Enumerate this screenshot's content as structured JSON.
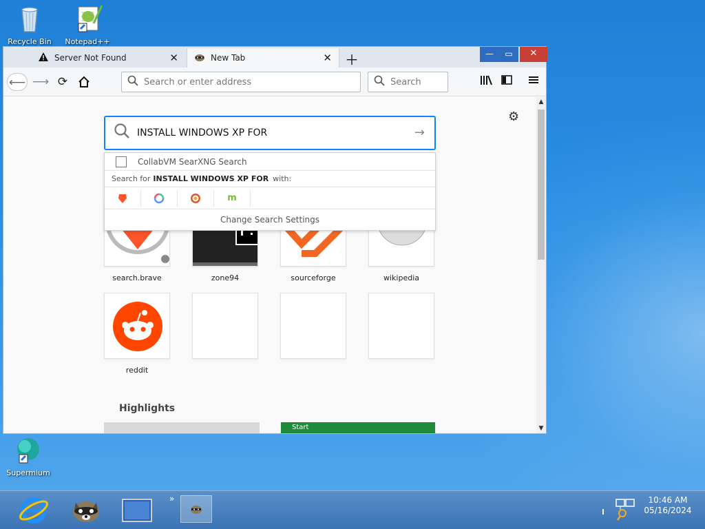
{
  "desktop": {
    "icons": [
      {
        "label": "Recycle Bin"
      },
      {
        "label": "Notepad++"
      },
      {
        "label": "Supermium"
      }
    ]
  },
  "browser": {
    "tabs": [
      {
        "title": "Server Not Found",
        "icon": "warning-icon"
      },
      {
        "title": "New Tab",
        "icon": "raccoon-icon"
      }
    ],
    "urlbar": {
      "placeholder": "Search or enter address"
    },
    "searchbar": {
      "placeholder": "Search"
    },
    "search_query": "INSTALL WINDOWS XP FOR",
    "suggestions": {
      "first_item": "CollabVM SearXNG Search",
      "search_for_prefix": "Search for",
      "search_for_query": "INSTALL WINDOWS XP FOR",
      "search_for_suffix": "with:",
      "engines": [
        {
          "name": "brave",
          "color": "#fb542b"
        },
        {
          "name": "qwant",
          "color": "#5c97ff"
        },
        {
          "name": "duckduckgo",
          "color": "#de5833"
        },
        {
          "name": "mojeek",
          "color": "#7ab93c"
        }
      ],
      "change_settings": "Change Search Settings"
    },
    "top_sites": [
      {
        "label": "search.brave"
      },
      {
        "label": "zone94"
      },
      {
        "label": "sourceforge"
      },
      {
        "label": "wikipedia"
      },
      {
        "label": "reddit"
      },
      {
        "label": ""
      },
      {
        "label": ""
      },
      {
        "label": ""
      }
    ],
    "highlights_title": "Highlights",
    "highlight_card_text": "Start"
  },
  "taskbar": {
    "time": "10:46 AM",
    "date": "05/16/2024"
  },
  "colors": {
    "accent": "#0a84ff",
    "close_button": "#c84035",
    "reddit": "#ff4500"
  }
}
